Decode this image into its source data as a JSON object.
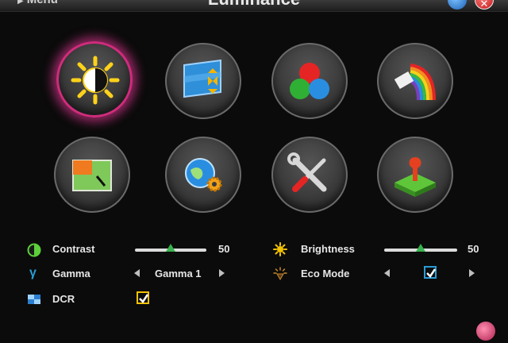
{
  "header": {
    "menu_label": "Menu",
    "title": "Luminance"
  },
  "tiles": [
    {
      "name": "luminance",
      "icon": "brightness-contrast-icon",
      "selected": true
    },
    {
      "name": "image-setup",
      "icon": "image-setup-icon",
      "selected": false
    },
    {
      "name": "color-temperature",
      "icon": "color-rgb-icon",
      "selected": false
    },
    {
      "name": "color-boost",
      "icon": "color-boost-icon",
      "selected": false
    },
    {
      "name": "picture-boost",
      "icon": "picture-boost-icon",
      "selected": false
    },
    {
      "name": "osd-setup",
      "icon": "osd-setup-icon",
      "selected": false
    },
    {
      "name": "extra",
      "icon": "tools-icon",
      "selected": false
    },
    {
      "name": "factory-reset",
      "icon": "reset-icon",
      "selected": false
    }
  ],
  "settings": {
    "contrast": {
      "label": "Contrast",
      "value": "50",
      "level": 0.5
    },
    "brightness": {
      "label": "Brightness",
      "value": "50",
      "level": 0.5
    },
    "gamma": {
      "label": "Gamma",
      "value": "Gamma 1"
    },
    "eco_mode": {
      "label": "Eco Mode",
      "checked": true
    },
    "dcr": {
      "label": "DCR",
      "checked": true
    }
  },
  "colors": {
    "selection_glow": "#d02c7c",
    "slider_thumb": "#37b24d",
    "checkbox_yellow": "#f2c200",
    "checkbox_blue": "#2a9bd6"
  }
}
